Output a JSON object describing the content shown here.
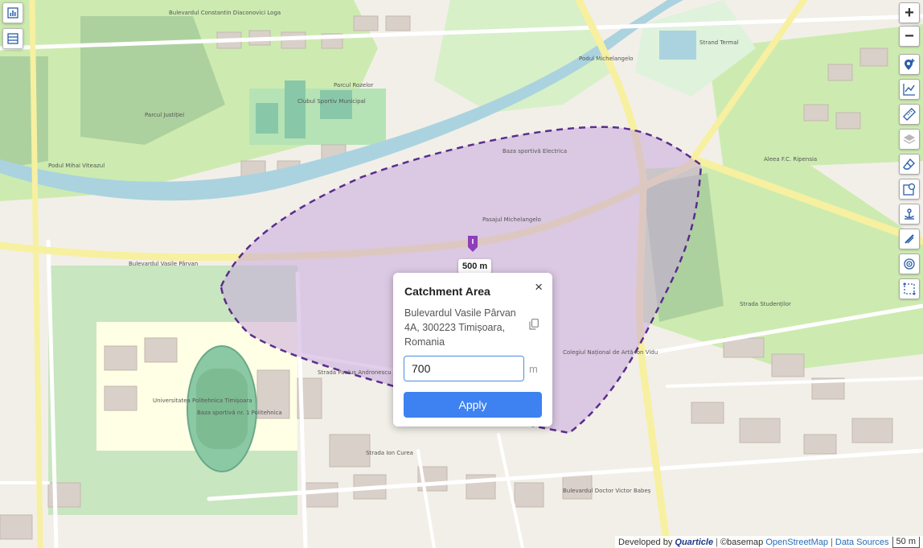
{
  "map": {
    "labels": {
      "bulevardul_loga": "Bulevardul Constantin Diaconovici Loga",
      "parcul_rozelor": "Parcul Rozelor",
      "clubul_sportiv": "Clubul Sportiv Municipal",
      "parcul_justitiei": "Parcul Justiției",
      "podul_mihai": "Podul Mihai Viteazul",
      "baza_electrica": "Baza sportivă Electrica",
      "podul_michelangelo": "Podul Michelangelo",
      "strand_termal": "Strand Termal",
      "pasajul": "Pasajul Michelangelo",
      "bulevardul_parvan": "Bulevardul Vasile Pârvan",
      "strada_paulus": "Strada Paulus Andronescu",
      "universitatea_poli": "Universitatea Politehnica Timișoara",
      "baza_poli": "Baza sportivă nr. 1 Politehnica",
      "colegiul": "Colegiul Național de Artă Ion Vidu",
      "bulevardul_babes": "Bulevardul Doctor Victor Babeș",
      "aleea_ripensia": "Aleea F.C. Ripensia",
      "strada_studentilor": "Strada Studenților",
      "strada_ion_curea": "Strada Ion Curea"
    }
  },
  "toolbar": {
    "left_icons": [
      "chart-icon",
      "layers-list-icon"
    ],
    "right_icons": [
      "zoom-in-icon",
      "zoom-out-icon",
      "add-marker-icon",
      "line-chart-icon",
      "ruler-icon",
      "layers-icon",
      "eraser-icon",
      "isochrone-icon",
      "anchor-icon",
      "clear-icon",
      "target-icon",
      "select-area-icon"
    ],
    "zoom_in_label": "+",
    "zoom_out_label": "−"
  },
  "radius_label": "500 m",
  "popup": {
    "title": "Catchment Area",
    "close_label": "×",
    "address": "Bulevardul Vasile Pârvan 4A, 300223 Timișoara, Romania",
    "radius_value": "700",
    "unit": "m",
    "apply_label": "Apply"
  },
  "attribution": {
    "developed_by": "Developed by",
    "brand": "Quarticle",
    "basemap": "©basemap",
    "osm": "OpenStreetMap",
    "data_sources": "Data Sources",
    "scale": "50 m"
  },
  "colors": {
    "accent": "#3d82f0",
    "catchment_fill": "#c8a8dc",
    "catchment_stroke": "#5a2d8c",
    "marker": "#8e3dbb",
    "park": "#c8e6c0",
    "river": "#aad3df"
  }
}
